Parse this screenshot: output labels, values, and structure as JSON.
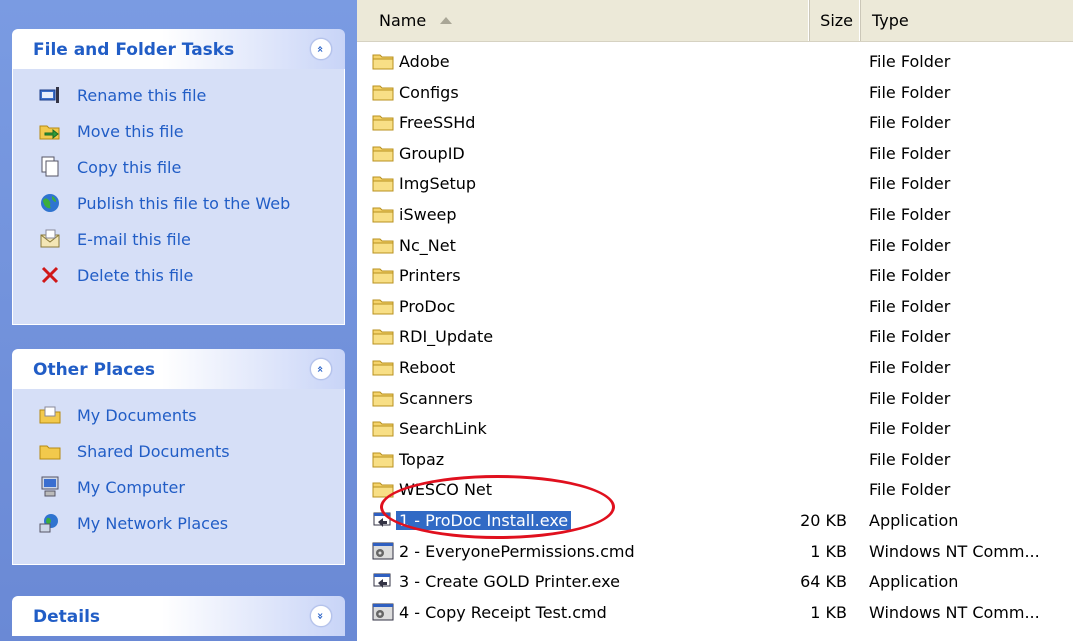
{
  "task_pane": {
    "file_folder_tasks": {
      "title": "File and Folder Tasks",
      "collapse_glyph": "«",
      "items": [
        {
          "label": "Rename this file",
          "icon": "rename-icon"
        },
        {
          "label": "Move this file",
          "icon": "move-icon"
        },
        {
          "label": "Copy this file",
          "icon": "copy-icon"
        },
        {
          "label": "Publish this file to the Web",
          "icon": "globe-icon"
        },
        {
          "label": "E-mail this file",
          "icon": "email-icon"
        },
        {
          "label": "Delete this file",
          "icon": "delete-icon"
        }
      ]
    },
    "other_places": {
      "title": "Other Places",
      "collapse_glyph": "«",
      "items": [
        {
          "label": "My Documents",
          "icon": "my-documents-icon"
        },
        {
          "label": "Shared Documents",
          "icon": "shared-documents-icon"
        },
        {
          "label": "My Computer",
          "icon": "my-computer-icon"
        },
        {
          "label": "My Network Places",
          "icon": "network-places-icon"
        }
      ]
    },
    "details": {
      "title": "Details",
      "expand_glyph": "»"
    }
  },
  "file_list": {
    "columns": {
      "name": "Name",
      "size": "Size",
      "type": "Type"
    },
    "rows": [
      {
        "name": "Adobe",
        "size": "",
        "type": "File Folder",
        "icon": "folder-icon"
      },
      {
        "name": "Configs",
        "size": "",
        "type": "File Folder",
        "icon": "folder-icon"
      },
      {
        "name": "FreeSSHd",
        "size": "",
        "type": "File Folder",
        "icon": "folder-icon"
      },
      {
        "name": "GroupID",
        "size": "",
        "type": "File Folder",
        "icon": "folder-icon"
      },
      {
        "name": "ImgSetup",
        "size": "",
        "type": "File Folder",
        "icon": "folder-icon"
      },
      {
        "name": "iSweep",
        "size": "",
        "type": "File Folder",
        "icon": "folder-icon"
      },
      {
        "name": "Nc_Net",
        "size": "",
        "type": "File Folder",
        "icon": "folder-icon"
      },
      {
        "name": "Printers",
        "size": "",
        "type": "File Folder",
        "icon": "folder-icon"
      },
      {
        "name": "ProDoc",
        "size": "",
        "type": "File Folder",
        "icon": "folder-icon"
      },
      {
        "name": "RDI_Update",
        "size": "",
        "type": "File Folder",
        "icon": "folder-icon"
      },
      {
        "name": "Reboot",
        "size": "",
        "type": "File Folder",
        "icon": "folder-icon"
      },
      {
        "name": "Scanners",
        "size": "",
        "type": "File Folder",
        "icon": "folder-icon"
      },
      {
        "name": "SearchLink",
        "size": "",
        "type": "File Folder",
        "icon": "folder-icon"
      },
      {
        "name": "Topaz",
        "size": "",
        "type": "File Folder",
        "icon": "folder-icon"
      },
      {
        "name": "WESCO Net",
        "size": "",
        "type": "File Folder",
        "icon": "folder-icon"
      },
      {
        "name": "1 - ProDoc Install.exe",
        "size": "20 KB",
        "type": "Application",
        "icon": "application-icon",
        "selected": true
      },
      {
        "name": "2 - EveryonePermissions.cmd",
        "size": "1 KB",
        "type": "Windows NT Comm...",
        "icon": "cmd-script-icon"
      },
      {
        "name": "3 - Create GOLD Printer.exe",
        "size": "64 KB",
        "type": "Application",
        "icon": "application-icon"
      },
      {
        "name": "4 - Copy Receipt Test.cmd",
        "size": "1 KB",
        "type": "Windows NT Comm...",
        "icon": "cmd-script-icon"
      }
    ]
  },
  "colors": {
    "pane_background": "#7a9be2",
    "panel_title": "#215dc6",
    "selection": "#316ac5",
    "annotation_circle": "#e0101e"
  }
}
